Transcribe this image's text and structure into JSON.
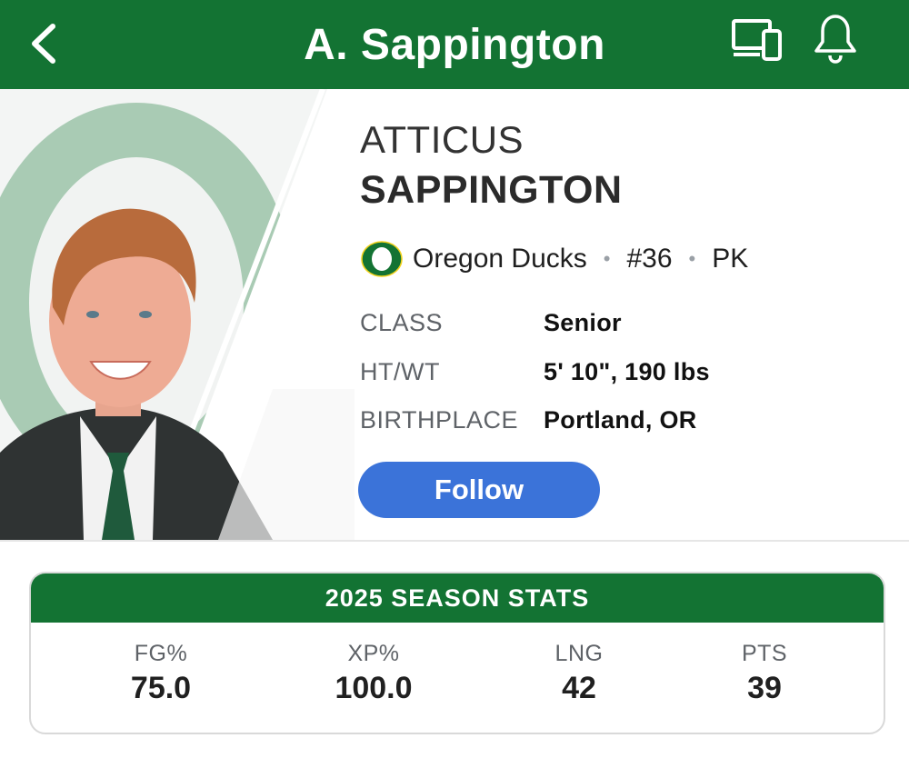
{
  "header": {
    "title": "A. Sappington",
    "back_icon": "chevron-left-icon",
    "device_icon": "devices-icon",
    "bell_icon": "bell-icon",
    "bg_color": "#137333"
  },
  "player": {
    "first_name": "ATTICUS",
    "last_name": "SAPPINGTON",
    "team": "Oregon Ducks",
    "number": "#36",
    "position": "PK",
    "team_logo_icon": "oregon-o-logo-icon"
  },
  "info": [
    {
      "label": "CLASS",
      "value": "Senior"
    },
    {
      "label": "HT/WT",
      "value": "5' 10\", 190 lbs"
    },
    {
      "label": "BIRTHPLACE",
      "value": "Portland, OR"
    }
  ],
  "follow_label": "Follow",
  "stats": {
    "title": "2025 SEASON STATS",
    "items": [
      {
        "label": "FG%",
        "value": "75.0"
      },
      {
        "label": "XP%",
        "value": "100.0"
      },
      {
        "label": "LNG",
        "value": "42"
      },
      {
        "label": "PTS",
        "value": "39"
      }
    ]
  },
  "colors": {
    "brand_green": "#137333",
    "follow_blue": "#3b73d9"
  }
}
